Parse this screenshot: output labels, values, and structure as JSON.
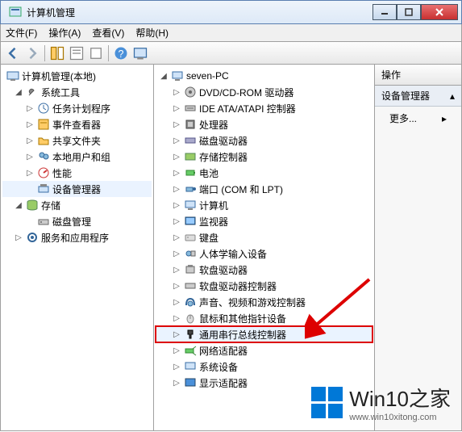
{
  "window": {
    "title": "计算机管理",
    "min": "–",
    "max": "▢",
    "close": "×"
  },
  "menu": {
    "file": "文件(F)",
    "action": "操作(A)",
    "view": "查看(V)",
    "help": "帮助(H)"
  },
  "left_tree": {
    "root": "计算机管理(本地)",
    "system_tools": "系统工具",
    "task_scheduler": "任务计划程序",
    "event_viewer": "事件查看器",
    "shared_folders": "共享文件夹",
    "local_users": "本地用户和组",
    "performance": "性能",
    "device_manager": "设备管理器",
    "storage": "存储",
    "disk_management": "磁盘管理",
    "services": "服务和应用程序"
  },
  "mid_tree": {
    "root": "seven-PC",
    "items": [
      "DVD/CD-ROM 驱动器",
      "IDE ATA/ATAPI 控制器",
      "处理器",
      "磁盘驱动器",
      "存储控制器",
      "电池",
      "端口 (COM 和 LPT)",
      "计算机",
      "监视器",
      "键盘",
      "人体学输入设备",
      "软盘驱动器",
      "软盘驱动器控制器",
      "声音、视频和游戏控制器",
      "鼠标和其他指针设备",
      "通用串行总线控制器",
      "网络适配器",
      "系统设备",
      "显示适配器"
    ],
    "highlighted_index": 15
  },
  "right": {
    "header": "操作",
    "sub": "设备管理器",
    "more": "更多..."
  },
  "watermark": {
    "brand": "Win10之家",
    "url": "www.win10xitong.com"
  }
}
